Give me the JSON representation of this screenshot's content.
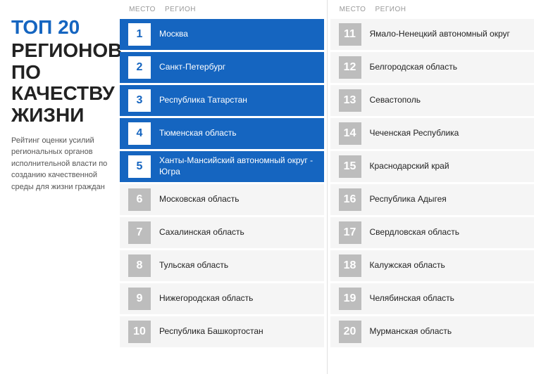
{
  "title": {
    "top": "ТОП 20",
    "main_line1": "РЕГИОНОВ",
    "main_line2": "ПО КАЧЕСТВУ",
    "main_line3": "ЖИЗНИ",
    "subtitle": "Рейтинг оценки усилий региональных органов исполнительной власти по созданию качественной среды для жизни граждан"
  },
  "columns": {
    "header_mesto": "МЕСТО",
    "header_region": "РЕГИОН"
  },
  "left_column": [
    {
      "rank": "1",
      "name": "Москва",
      "highlight": true
    },
    {
      "rank": "2",
      "name": "Санкт-Петербург",
      "highlight": true
    },
    {
      "rank": "3",
      "name": "Республика Татарстан",
      "highlight": true
    },
    {
      "rank": "4",
      "name": "Тюменская область",
      "highlight": true
    },
    {
      "rank": "5",
      "name": "Ханты-Мансийский автономный округ - Югра",
      "highlight": true
    },
    {
      "rank": "6",
      "name": "Московская область",
      "highlight": false
    },
    {
      "rank": "7",
      "name": "Сахалинская область",
      "highlight": false
    },
    {
      "rank": "8",
      "name": "Тульская область",
      "highlight": false
    },
    {
      "rank": "9",
      "name": "Нижегородская область",
      "highlight": false
    },
    {
      "rank": "10",
      "name": "Республика Башкортостан",
      "highlight": false
    }
  ],
  "right_column": [
    {
      "rank": "11",
      "name": "Ямало-Ненецкий автономный округ",
      "highlight": false
    },
    {
      "rank": "12",
      "name": "Белгородская область",
      "highlight": false
    },
    {
      "rank": "13",
      "name": "Севастополь",
      "highlight": false
    },
    {
      "rank": "14",
      "name": "Чеченская Республика",
      "highlight": false
    },
    {
      "rank": "15",
      "name": "Краснодарский край",
      "highlight": false
    },
    {
      "rank": "16",
      "name": "Республика Адыгея",
      "highlight": false
    },
    {
      "rank": "17",
      "name": "Свердловская область",
      "highlight": false
    },
    {
      "rank": "18",
      "name": "Калужская область",
      "highlight": false
    },
    {
      "rank": "19",
      "name": "Челябинская область",
      "highlight": false
    },
    {
      "rank": "20",
      "name": "Мурманская область",
      "highlight": false
    }
  ]
}
